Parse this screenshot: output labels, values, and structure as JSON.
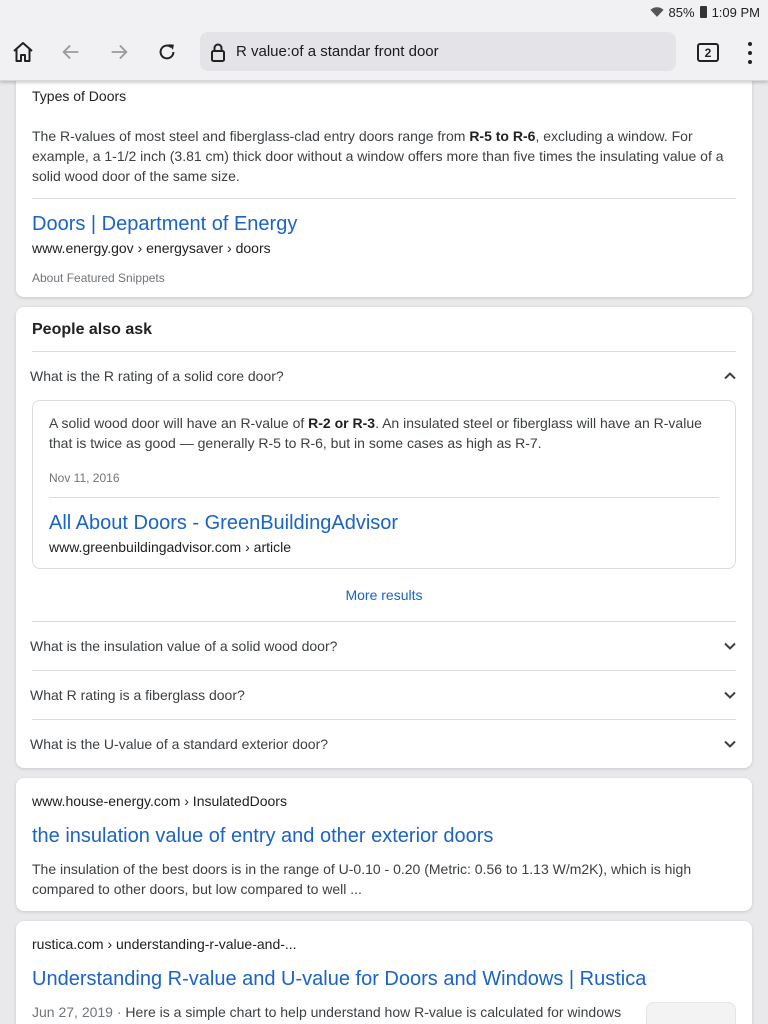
{
  "status": {
    "battery": "85%",
    "time": "1:09 PM"
  },
  "browser": {
    "url": "R value:of a standar front door",
    "tab_count": "2"
  },
  "snippet_card": {
    "heading": "Types of Doors",
    "text_pre": "The R-values of most steel and fiberglass-clad entry doors range from ",
    "text_bold": "R-5 to R-6",
    "text_post": ", excluding a window. For example, a 1-1/2 inch (3.81 cm) thick door without a window offers more than five times the insulating value of a solid wood door of the same size.",
    "link_title": "Doors | Department of Energy",
    "cite": "www.energy.gov › energysaver › doors",
    "about": "About Featured Snippets"
  },
  "paa": {
    "title": "People also ask",
    "expanded_question": "What is the R rating of a solid core door?",
    "answer_pre": "A solid wood door will have an R-value of ",
    "answer_bold": "R-2 or R-3",
    "answer_post": ". An insulated steel or fiberglass will have an R-value that is twice as good — generally R-5 to R-6, but in some cases as high as R-7.",
    "answer_date": "Nov 11, 2016",
    "answer_link_title": "All About Doors - GreenBuildingAdvisor",
    "answer_cite": "www.greenbuildingadvisor.com › article",
    "more_results": "More results",
    "questions": [
      "What is the insulation value of a solid wood door?",
      "What R rating is a fiberglass door?",
      "What is the U-value of a standard exterior door?"
    ]
  },
  "result_house": {
    "cite": "www.house-energy.com › InsulatedDoors",
    "title": "the insulation value of entry and other exterior doors",
    "snippet": "The insulation of the best doors is in the range of U-0.10 - 0.20 (Metric: 0.56 to 1.13 W/m2K), which is high compared to other doors, but low compared to well ..."
  },
  "result_rustica": {
    "cite": "rustica.com › understanding-r-value-and-...",
    "title": "Understanding R-value and U-value for Doors and Windows | Rustica",
    "date": "Jun 27, 2019",
    "separator": " · ",
    "snippet": "Here is a simple chart to help understand how R-value is calculated for windows"
  },
  "colors": {
    "link": "#1a63c7",
    "toolbar": "#f1f1f4",
    "background": "#e9e9ec"
  }
}
